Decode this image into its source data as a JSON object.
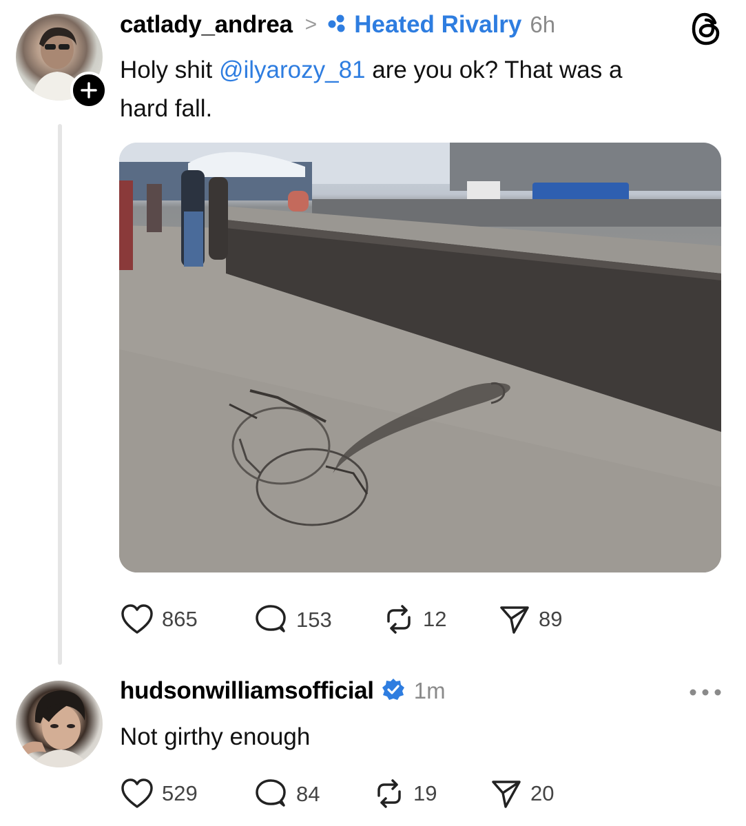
{
  "post": {
    "username": "catlady_andrea",
    "separator": ">",
    "community": "Heated Rivalry",
    "time": "6h",
    "text_prefix": "Holy shit ",
    "mention": "@ilyarozy_81",
    "text_suffix": " are you ok? That was a",
    "text_line2": "hard fall.",
    "stats": {
      "likes": "865",
      "replies": "153",
      "reposts": "12",
      "shares": "89"
    }
  },
  "reply": {
    "username": "hudsonwilliamsofficial",
    "time": "1m",
    "text": "Not girthy enough",
    "stats": {
      "likes": "529",
      "replies": "84",
      "reposts": "19",
      "shares": "20"
    }
  },
  "icons": {
    "app_logo": "threads-logo-icon",
    "follow": "plus-icon",
    "community": "community-dots-icon",
    "verified": "verified-badge-icon",
    "more": "more-icon",
    "like": "heart-icon",
    "reply": "comment-icon",
    "repost": "repost-icon",
    "share": "send-icon"
  },
  "colors": {
    "link": "#2e7de0",
    "meta": "#8a8a8a",
    "text": "#111111",
    "thread_line": "#e5e5e5"
  }
}
